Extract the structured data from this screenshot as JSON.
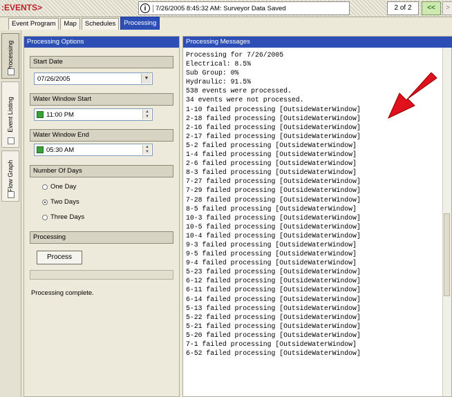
{
  "app": {
    "title": ":EVENTS>"
  },
  "status": {
    "text": "7/26/2005 8:45:32 AM: Surveyor Data Saved",
    "page": "2 of 2",
    "prev_label": "<<",
    "next_label": ">"
  },
  "tabs": [
    {
      "label": "Event Program"
    },
    {
      "label": "Map"
    },
    {
      "label": "Schedules"
    },
    {
      "label": "Processing",
      "active": true
    }
  ],
  "side_tabs": [
    {
      "label": "Processing",
      "active": true
    },
    {
      "label": "Event Listing"
    },
    {
      "label": "Flow Graph"
    }
  ],
  "options": {
    "header": "Processing Options",
    "start_date": {
      "label": "Start Date",
      "value": "07/26/2005"
    },
    "window_start": {
      "label": "Water Window Start",
      "value": "11:00 PM"
    },
    "window_end": {
      "label": "Water Window End",
      "value": "05:30 AM"
    },
    "days": {
      "label": "Number Of Days",
      "options": [
        "One Day",
        "Two Days",
        "Three Days"
      ],
      "selected": "Two Days"
    },
    "processing": {
      "label": "Processing",
      "button": "Process",
      "progress": 0,
      "status": "Processing complete."
    }
  },
  "messages": {
    "header": "Processing Messages",
    "lines": [
      "Processing for 7/26/2005",
      "Electrical: 8.5%",
      "Sub Group: 0%",
      "Hydraulic: 91.5%",
      "538 events were processed.",
      "34 events were not processed.",
      "1-10 failed processing [OutsideWaterWindow]",
      "2-18 failed processing [OutsideWaterWindow]",
      "2-16 failed processing [OutsideWaterWindow]",
      "2-17 failed processing [OutsideWaterWindow]",
      "5-2 failed processing [OutsideWaterWindow]",
      "1-4 failed processing [OutsideWaterWindow]",
      "2-6 failed processing [OutsideWaterWindow]",
      "8-3 failed processing [OutsideWaterWindow]",
      "7-27 failed processing [OutsideWaterWindow]",
      "7-29 failed processing [OutsideWaterWindow]",
      "7-28 failed processing [OutsideWaterWindow]",
      "8-5 failed processing [OutsideWaterWindow]",
      "10-3 failed processing [OutsideWaterWindow]",
      "10-5 failed processing [OutsideWaterWindow]",
      "10-4 failed processing [OutsideWaterWindow]",
      "9-3 failed processing [OutsideWaterWindow]",
      "9-5 failed processing [OutsideWaterWindow]",
      "9-4 failed processing [OutsideWaterWindow]",
      "5-23 failed processing [OutsideWaterWindow]",
      "6-12 failed processing [OutsideWaterWindow]",
      "6-11 failed processing [OutsideWaterWindow]",
      "6-14 failed processing [OutsideWaterWindow]",
      "5-13 failed processing [OutsideWaterWindow]",
      "5-22 failed processing [OutsideWaterWindow]",
      "5-21 failed processing [OutsideWaterWindow]",
      "5-20 failed processing [OutsideWaterWindow]",
      "7-1 failed processing [OutsideWaterWindow]",
      "6-52 failed processing [OutsideWaterWindow]"
    ]
  },
  "colors": {
    "accent": "#2d4fb5",
    "arrow": "#e0101c",
    "title": "#c0202a",
    "check": "#39a03a"
  },
  "icons": {
    "info": "info-icon",
    "arrow": "red-arrow-annotation"
  }
}
